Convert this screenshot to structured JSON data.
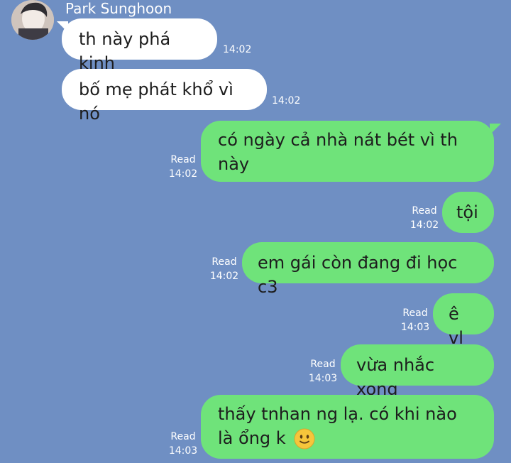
{
  "chat": {
    "contact_name": "Park Sunghoon",
    "messages": [
      {
        "direction": "in",
        "text": "th này phá kinh",
        "time": "14:02"
      },
      {
        "direction": "in",
        "text": "bố mẹ phát khổ vì nó",
        "time": "14:02"
      },
      {
        "direction": "out",
        "text": "có ngày cả nhà nát bét vì th này",
        "read": "Read",
        "time": "14:02"
      },
      {
        "direction": "out",
        "text": "tội",
        "read": "Read",
        "time": "14:02"
      },
      {
        "direction": "out",
        "text": "em gái còn đang đi học c3",
        "read": "Read",
        "time": "14:02"
      },
      {
        "direction": "out",
        "text": "ê vl",
        "read": "Read",
        "time": "14:03"
      },
      {
        "direction": "out",
        "text": "vừa nhắc xong",
        "read": "Read",
        "time": "14:03"
      },
      {
        "direction": "out",
        "text": "thấy tnhan ng lạ. có khi nào là ổng k",
        "emoji": "slightly-smiling-face-emoji",
        "read": "Read",
        "time": "14:03"
      }
    ]
  },
  "colors": {
    "background": "#6f8fc3",
    "incoming_bubble": "#ffffff",
    "outgoing_bubble": "#6fe37a"
  }
}
